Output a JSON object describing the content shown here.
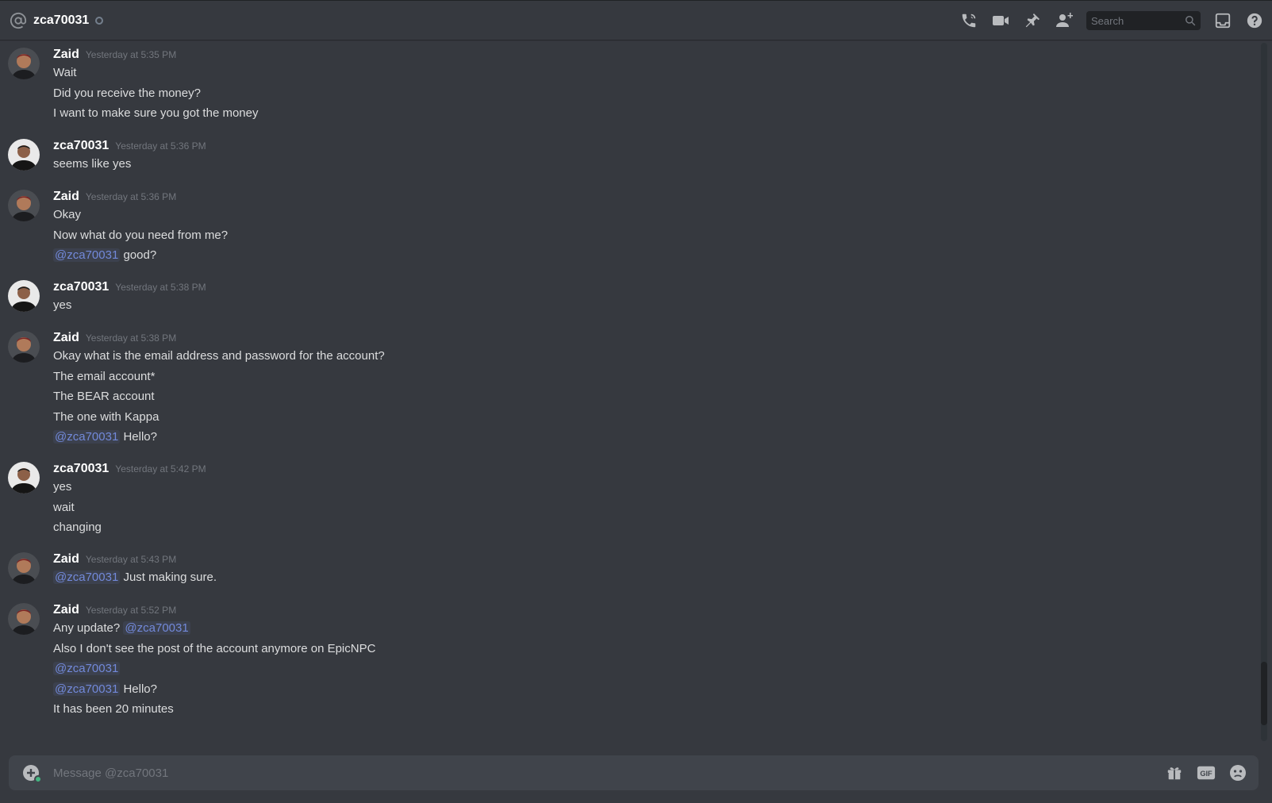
{
  "header": {
    "channel_name": "zca70031",
    "search_placeholder": "Search",
    "icons": [
      "at-icon",
      "phone-icon",
      "video-icon",
      "pin-icon",
      "add-friend-icon",
      "search-icon",
      "inbox-icon",
      "help-icon"
    ]
  },
  "messages": [
    {
      "author": "Zaid",
      "timestamp": "Yesterday at 5:35 PM",
      "avatar": "zaid",
      "lines": [
        {
          "parts": [
            {
              "text": "Wait"
            }
          ]
        },
        {
          "parts": [
            {
              "text": "Did you receive the money?"
            }
          ]
        },
        {
          "parts": [
            {
              "text": "I want to make sure you got the money"
            }
          ]
        }
      ]
    },
    {
      "author": "zca70031",
      "timestamp": "Yesterday at 5:36 PM",
      "avatar": "zca",
      "lines": [
        {
          "parts": [
            {
              "text": "seems like yes"
            }
          ]
        }
      ]
    },
    {
      "author": "Zaid",
      "timestamp": "Yesterday at 5:36 PM",
      "avatar": "zaid",
      "lines": [
        {
          "parts": [
            {
              "text": "Okay"
            }
          ]
        },
        {
          "parts": [
            {
              "text": "Now what do you need from me?"
            }
          ]
        },
        {
          "parts": [
            {
              "text": "@zca70031",
              "mention": true
            },
            {
              "text": " good?"
            }
          ]
        }
      ]
    },
    {
      "author": "zca70031",
      "timestamp": "Yesterday at 5:38 PM",
      "avatar": "zca",
      "lines": [
        {
          "parts": [
            {
              "text": "yes"
            }
          ]
        }
      ]
    },
    {
      "author": "Zaid",
      "timestamp": "Yesterday at 5:38 PM",
      "avatar": "zaid",
      "lines": [
        {
          "parts": [
            {
              "text": "Okay what is the email address and password for the account?"
            }
          ]
        },
        {
          "parts": [
            {
              "text": "The email account*"
            }
          ]
        },
        {
          "parts": [
            {
              "text": "The BEAR account"
            }
          ]
        },
        {
          "parts": [
            {
              "text": "The one with Kappa"
            }
          ]
        },
        {
          "parts": [
            {
              "text": "@zca70031",
              "mention": true
            },
            {
              "text": " Hello?"
            }
          ]
        }
      ]
    },
    {
      "author": "zca70031",
      "timestamp": "Yesterday at 5:42 PM",
      "avatar": "zca",
      "lines": [
        {
          "parts": [
            {
              "text": "yes"
            }
          ]
        },
        {
          "parts": [
            {
              "text": "wait"
            }
          ]
        },
        {
          "parts": [
            {
              "text": "changing"
            }
          ]
        }
      ]
    },
    {
      "author": "Zaid",
      "timestamp": "Yesterday at 5:43 PM",
      "avatar": "zaid",
      "lines": [
        {
          "parts": [
            {
              "text": "@zca70031",
              "mention": true
            },
            {
              "text": " Just making sure."
            }
          ]
        }
      ]
    },
    {
      "author": "Zaid",
      "timestamp": "Yesterday at 5:52 PM",
      "avatar": "zaid",
      "lines": [
        {
          "parts": [
            {
              "text": "Any update? "
            },
            {
              "text": "@zca70031",
              "mention": true
            }
          ]
        },
        {
          "parts": [
            {
              "text": "Also I don't see the post of the account anymore on EpicNPC"
            }
          ]
        },
        {
          "parts": [
            {
              "text": "@zca70031",
              "mention": true
            }
          ]
        },
        {
          "parts": [
            {
              "text": "@zca70031",
              "mention": true
            },
            {
              "text": " Hello?"
            }
          ]
        },
        {
          "parts": [
            {
              "text": "It has been 20 minutes"
            }
          ]
        }
      ]
    }
  ],
  "composer": {
    "placeholder": "Message @zca70031",
    "icons": [
      "attach-plus-icon",
      "gift-icon",
      "gif-icon",
      "emoji-icon"
    ],
    "gif_label": "GIF"
  },
  "colors": {
    "background": "#36393f",
    "mention": "#7289da",
    "timestamp": "#72767d",
    "composer": "#40444b"
  }
}
